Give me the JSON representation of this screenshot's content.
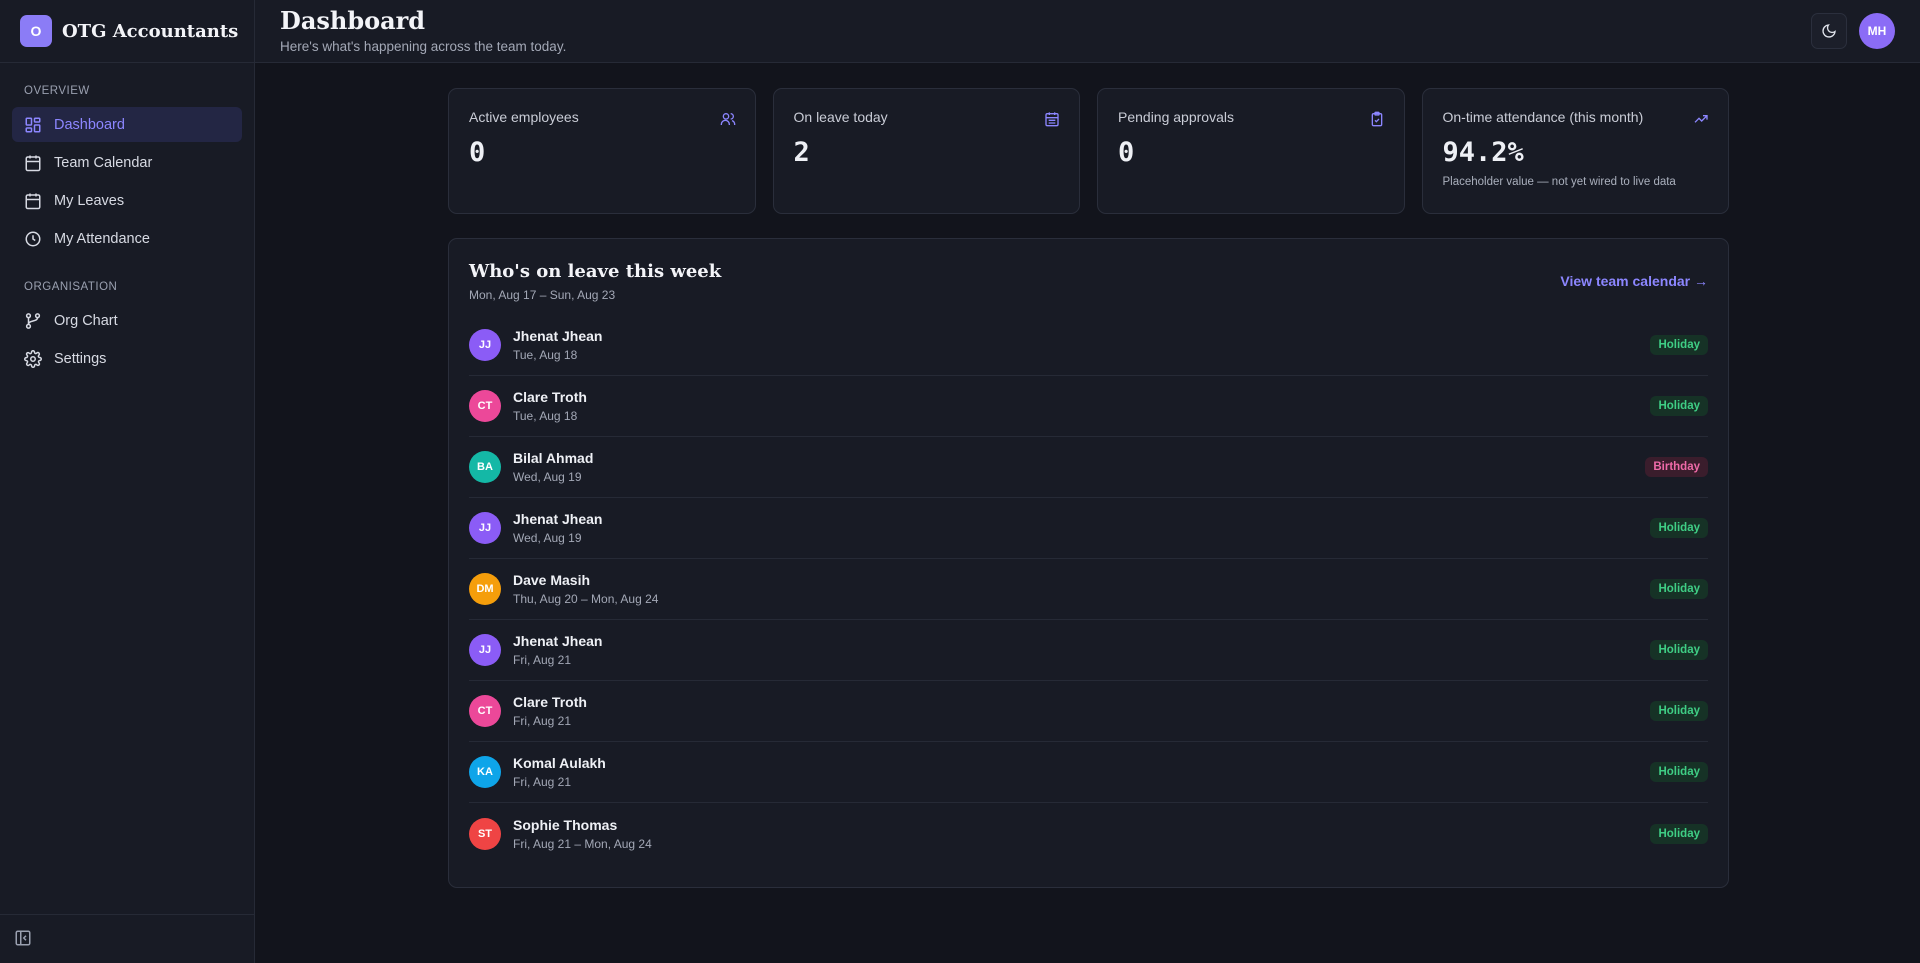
{
  "brand": {
    "logo_letter": "O",
    "name": "OTG Accountants"
  },
  "sidebar": {
    "sections": [
      {
        "title": "OVERVIEW",
        "items": [
          {
            "label": "Dashboard",
            "icon": "dashboard-icon",
            "active": true
          },
          {
            "label": "Team Calendar",
            "icon": "calendar-icon"
          },
          {
            "label": "My Leaves",
            "icon": "calendar-icon"
          },
          {
            "label": "My Attendance",
            "icon": "clock-icon"
          }
        ]
      },
      {
        "title": "ORGANISATION",
        "items": [
          {
            "label": "Org Chart",
            "icon": "branch-icon"
          },
          {
            "label": "Settings",
            "icon": "gear-icon"
          }
        ]
      }
    ]
  },
  "header": {
    "title": "Dashboard",
    "subtitle": "Here's what's happening across the team today.",
    "user_initials": "MH"
  },
  "stats": [
    {
      "label": "Active employees",
      "value": "0",
      "icon": "users-icon",
      "note": ""
    },
    {
      "label": "On leave today",
      "value": "2",
      "icon": "calendar-days-icon",
      "note": ""
    },
    {
      "label": "Pending approvals",
      "value": "0",
      "icon": "clipboard-check-icon",
      "note": ""
    },
    {
      "label": "On-time attendance (this month)",
      "value": "94.2%",
      "icon": "trending-up-icon",
      "note": "Placeholder value — not yet wired to live data"
    }
  ],
  "leave_panel": {
    "title": "Who's on leave this week",
    "subtitle": "Mon, Aug 17 – Sun, Aug 23",
    "link": "View team calendar →",
    "rows": [
      {
        "initials": "JJ",
        "name": "Jhenat Jhean",
        "date": "Tue, Aug 18",
        "type": "Holiday",
        "color": "#8b5cf6"
      },
      {
        "initials": "CT",
        "name": "Clare Troth",
        "date": "Tue, Aug 18",
        "type": "Holiday",
        "color": "#ec4899"
      },
      {
        "initials": "BA",
        "name": "Bilal Ahmad",
        "date": "Wed, Aug 19",
        "type": "Birthday",
        "color": "#14b8a6"
      },
      {
        "initials": "JJ",
        "name": "Jhenat Jhean",
        "date": "Wed, Aug 19",
        "type": "Holiday",
        "color": "#8b5cf6"
      },
      {
        "initials": "DM",
        "name": "Dave Masih",
        "date": "Thu, Aug 20 – Mon, Aug 24",
        "type": "Holiday",
        "color": "#f59e0b"
      },
      {
        "initials": "JJ",
        "name": "Jhenat Jhean",
        "date": "Fri, Aug 21",
        "type": "Holiday",
        "color": "#8b5cf6"
      },
      {
        "initials": "CT",
        "name": "Clare Troth",
        "date": "Fri, Aug 21",
        "type": "Holiday",
        "color": "#ec4899"
      },
      {
        "initials": "KA",
        "name": "Komal Aulakh",
        "date": "Fri, Aug 21",
        "type": "Holiday",
        "color": "#0ea5e9"
      },
      {
        "initials": "ST",
        "name": "Sophie Thomas",
        "date": "Fri, Aug 21 – Mon, Aug 24",
        "type": "Holiday",
        "color": "#ef4444"
      }
    ]
  },
  "colors": {
    "accent": "#8c86ff",
    "holiday": "#3fce85",
    "birthday": "#ef6aa8",
    "background": "#12141c"
  }
}
